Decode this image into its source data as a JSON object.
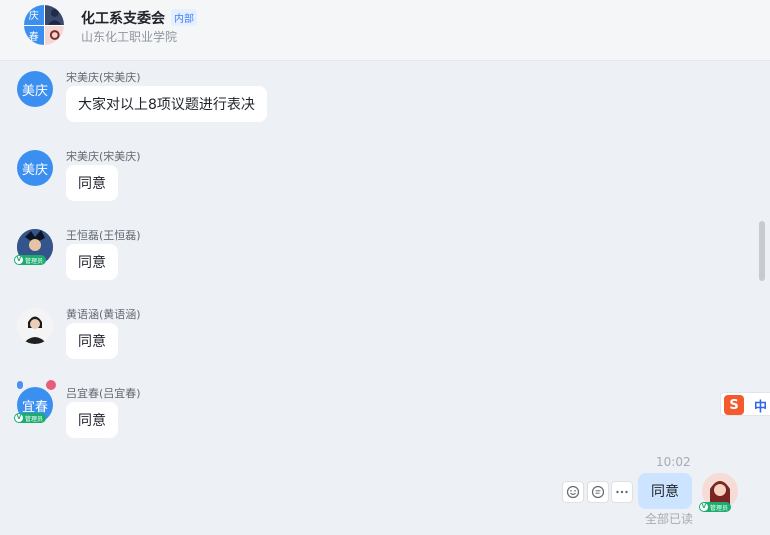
{
  "header": {
    "group_name": "化工系支委会",
    "internal_tag": "内部",
    "subtitle": "山东化工职业学院",
    "group_avatar_chars": [
      "庆",
      "春"
    ]
  },
  "messages": [
    {
      "sender": "宋美庆(宋美庆)",
      "avatar_text": "美庆",
      "text": "大家对以上8项议题进行表决"
    },
    {
      "sender": "宋美庆(宋美庆)",
      "avatar_text": "美庆",
      "text": "同意"
    },
    {
      "sender": "王恒磊(王恒磊)",
      "text": "同意",
      "badge": "管理员"
    },
    {
      "sender": "黄语涵(黄语涵)",
      "text": "同意"
    },
    {
      "sender": "吕宜春(吕宜春)",
      "avatar_text": "宜春",
      "text": "同意",
      "badge": "管理员"
    }
  ],
  "own_message": {
    "time": "10:02",
    "text": "同意",
    "read_status": "全部已读",
    "badge": "管理员"
  },
  "ime": {
    "icon": "S",
    "label": "中"
  },
  "colors": {
    "accent": "#3b8ff0",
    "own_bubble": "#cce4ff",
    "admin_badge": "#1aad6e",
    "background": "#edf0f5"
  }
}
